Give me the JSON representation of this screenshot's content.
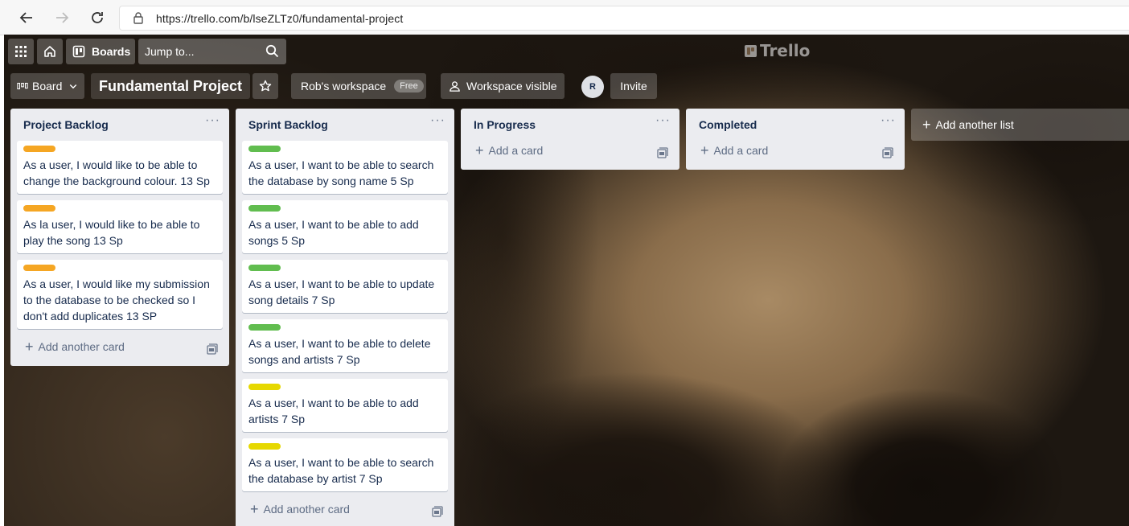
{
  "browser": {
    "url": "https://trello.com/b/lseZLTz0/fundamental-project"
  },
  "header": {
    "boards_label": "Boards",
    "search_placeholder": "Jump to...",
    "logo_text": "Trello"
  },
  "board_header": {
    "view_label": "Board",
    "title": "Fundamental Project",
    "workspace_label": "Rob's workspace",
    "workspace_badge": "Free",
    "visibility_label": "Workspace visible",
    "avatar_initial": "R",
    "invite_label": "Invite"
  },
  "lists": [
    {
      "title": "Project Backlog",
      "add_label": "Add another card",
      "cards": [
        {
          "label_color": "#f5a623",
          "text": "As a user, I would like to be able to change the background colour. 13 Sp"
        },
        {
          "label_color": "#f5a623",
          "text": "As la user, I would like to be able to play the song 13 Sp"
        },
        {
          "label_color": "#f5a623",
          "text": "As a user, I would like my submission to the database to be checked so I don't add duplicates 13 SP"
        }
      ]
    },
    {
      "title": "Sprint Backlog",
      "add_label": "Add another card",
      "cards": [
        {
          "label_color": "#61bd4f",
          "text": "As a user, I want to be able to search the database by song name 5 Sp"
        },
        {
          "label_color": "#61bd4f",
          "text": "As a user, I want to be able to add songs 5 Sp"
        },
        {
          "label_color": "#61bd4f",
          "text": "As a user, I want to be able to update song details 7 Sp"
        },
        {
          "label_color": "#61bd4f",
          "text": "As a user, I want to be able to delete songs and artists 7 Sp"
        },
        {
          "label_color": "#e6d800",
          "text": "As a user, I want to be able to add artists 7 Sp"
        },
        {
          "label_color": "#e6d800",
          "text": "As a user, I want to be able to search the database by artist 7 Sp"
        }
      ]
    },
    {
      "title": "In Progress",
      "add_label": "Add a card",
      "cards": []
    },
    {
      "title": "Completed",
      "add_label": "Add a card",
      "cards": []
    }
  ],
  "add_list_label": "Add another list"
}
